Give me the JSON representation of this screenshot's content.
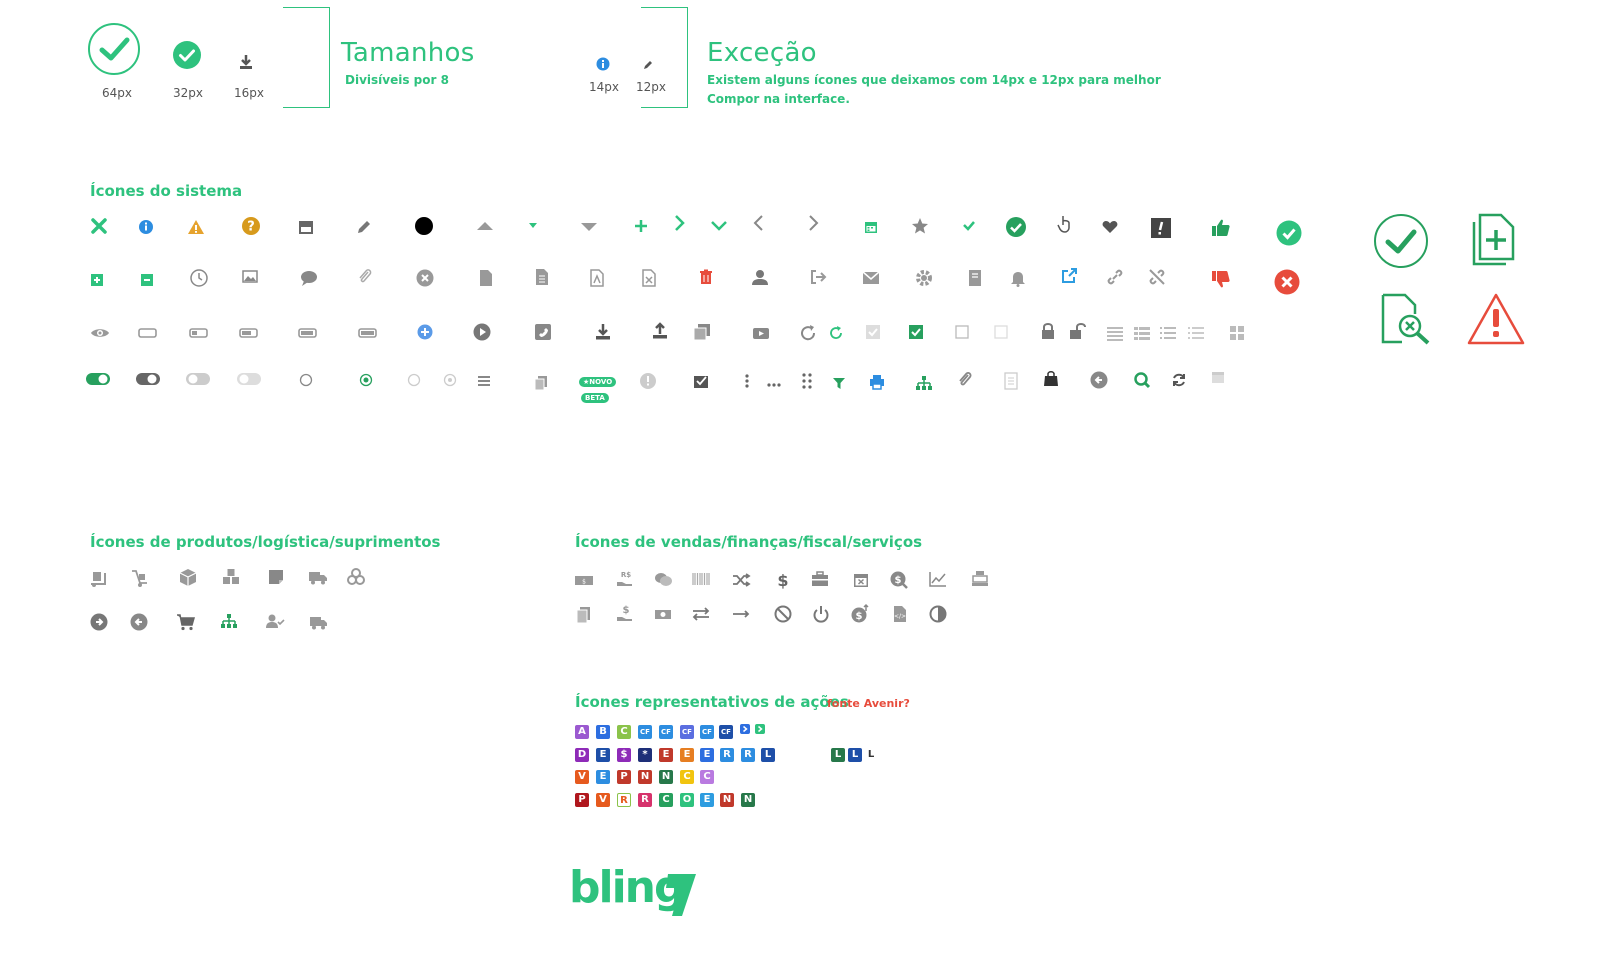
{
  "sizes": {
    "title": "Tamanhos",
    "subtitle": "Divisíveis por 8",
    "labels": [
      "64px",
      "32px",
      "16px"
    ]
  },
  "exception": {
    "title": "Exceção",
    "subtitle_line1": "Existem alguns ícones que deixamos com 14px e 12px para melhor",
    "subtitle_line2": "Compor na interface.",
    "labels": [
      "14px",
      "12px"
    ]
  },
  "sections": {
    "system": "Ícones do sistema",
    "products": "Ícones de produtos/logística/suprimentos",
    "sales": "Ícones de vendas/finanças/fiscal/serviços",
    "actions": "Ícones representativos de ações",
    "actions_note": "fonte Avenir?"
  },
  "badges": {
    "novo": "★NOVO",
    "beta": "BETA"
  },
  "action_letters": {
    "row1": [
      "A",
      "B",
      "C",
      "CF",
      "CF",
      "CF",
      "CF",
      "CF"
    ],
    "row2": [
      "D",
      "E",
      "$",
      "*",
      "E",
      "E",
      "E",
      "R",
      "R",
      "L"
    ],
    "row3": [
      "V",
      "E",
      "P",
      "N",
      "N",
      "C",
      "C"
    ],
    "row4": [
      "P",
      "V",
      "R",
      "R",
      "C",
      "O",
      "E",
      "N",
      "N"
    ],
    "extra": [
      "L",
      "L",
      "L"
    ]
  },
  "logo": "bling",
  "colors": {
    "accent": "#2ec27e",
    "gray": "#8a8a8a",
    "red": "#e74c3c",
    "blue": "#2d8de0",
    "orange": "#e6a32e"
  }
}
